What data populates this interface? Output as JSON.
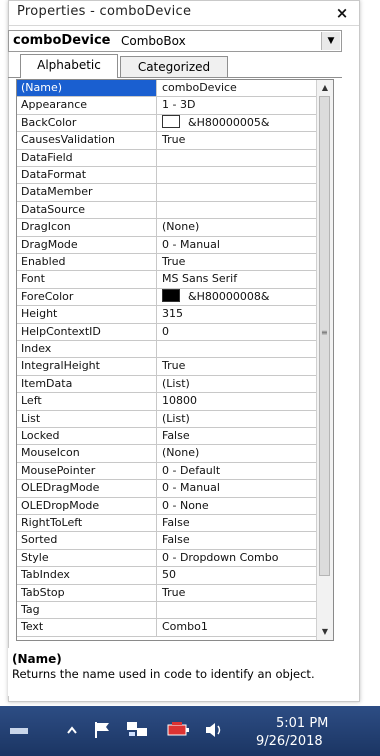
{
  "window": {
    "title": "Properties - comboDevice",
    "close_glyph": "×"
  },
  "object_selector": {
    "name": "comboDevice",
    "type": "ComboBox",
    "arrow_glyph": "▼"
  },
  "tabs": [
    {
      "label": "Alphabetic",
      "active": true
    },
    {
      "label": "Categorized",
      "active": false
    }
  ],
  "properties": [
    {
      "name": "(Name)",
      "value": "comboDevice",
      "selected": true
    },
    {
      "name": "Appearance",
      "value": "1 - 3D"
    },
    {
      "name": "BackColor",
      "value": "&H80000005&",
      "swatch": "#ffffff"
    },
    {
      "name": "CausesValidation",
      "value": "True"
    },
    {
      "name": "DataField",
      "value": ""
    },
    {
      "name": "DataFormat",
      "value": ""
    },
    {
      "name": "DataMember",
      "value": ""
    },
    {
      "name": "DataSource",
      "value": ""
    },
    {
      "name": "DragIcon",
      "value": "(None)"
    },
    {
      "name": "DragMode",
      "value": "0 - Manual"
    },
    {
      "name": "Enabled",
      "value": "True"
    },
    {
      "name": "Font",
      "value": "MS Sans Serif"
    },
    {
      "name": "ForeColor",
      "value": "&H80000008&",
      "swatch": "#000000"
    },
    {
      "name": "Height",
      "value": "315"
    },
    {
      "name": "HelpContextID",
      "value": "0"
    },
    {
      "name": "Index",
      "value": ""
    },
    {
      "name": "IntegralHeight",
      "value": "True"
    },
    {
      "name": "ItemData",
      "value": "(List)"
    },
    {
      "name": "Left",
      "value": "10800"
    },
    {
      "name": "List",
      "value": "(List)"
    },
    {
      "name": "Locked",
      "value": "False"
    },
    {
      "name": "MouseIcon",
      "value": "(None)"
    },
    {
      "name": "MousePointer",
      "value": "0 - Default"
    },
    {
      "name": "OLEDragMode",
      "value": "0 - Manual"
    },
    {
      "name": "OLEDropMode",
      "value": "0 - None"
    },
    {
      "name": "RightToLeft",
      "value": "False"
    },
    {
      "name": "Sorted",
      "value": "False"
    },
    {
      "name": "Style",
      "value": "0 - Dropdown Combo"
    },
    {
      "name": "TabIndex",
      "value": "50"
    },
    {
      "name": "TabStop",
      "value": "True"
    },
    {
      "name": "Tag",
      "value": ""
    },
    {
      "name": "Text",
      "value": "Combo1"
    }
  ],
  "scrollbar": {
    "up_glyph": "▲",
    "down_glyph": "▼",
    "grip_glyph": "≡"
  },
  "description": {
    "title": "(Name)",
    "text": "Returns the name used in code to identify an object."
  },
  "taskbar": {
    "icons": [
      "start-icon",
      "chevron-up-icon",
      "flag-icon",
      "network-icon",
      "battery-icon",
      "speaker-icon"
    ],
    "time": "5:01 PM",
    "date": "9/26/2018"
  },
  "colors": {
    "selection": "#1a5fd0",
    "taskbar": "#1b3563"
  }
}
